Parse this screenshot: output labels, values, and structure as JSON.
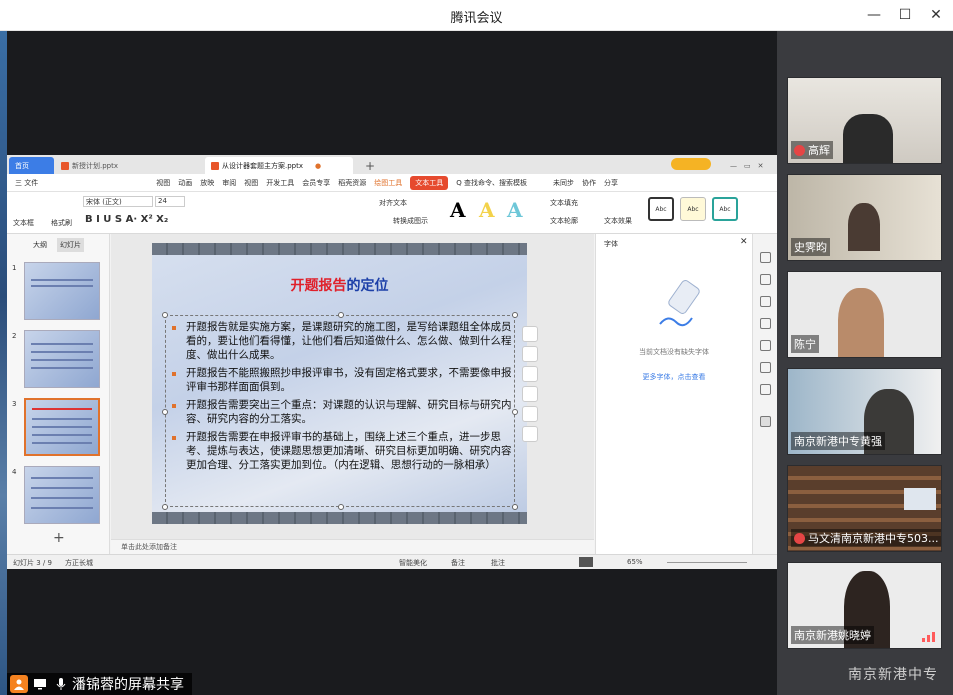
{
  "window": {
    "title": "腾讯会议"
  },
  "presenter": {
    "label": "潘锦蓉的屏幕共享"
  },
  "participants": [
    {
      "name": "高辉",
      "muted": true
    },
    {
      "name": "史霁昀",
      "muted": false
    },
    {
      "name": "陈宁",
      "muted": false
    },
    {
      "name": "南京新港中专黄强",
      "muted": false
    },
    {
      "name": "马文清南京新港中专503...",
      "muted": true
    },
    {
      "name": "南京新港姚晓婷",
      "muted": false
    }
  ],
  "watermark": "南京新港中专",
  "wps": {
    "tabs": {
      "home": "首页",
      "doc1": "新授计划.pptx",
      "doc2": "从设计器套题主方案.pptx"
    },
    "menu": [
      "三 文件",
      "视图",
      "动画",
      "放映",
      "审阅",
      "视图",
      "开发工具",
      "会员专享",
      "稻壳资源",
      "绘图工具",
      "文本工具",
      "Q 查找命令、搜索模板",
      "未同步",
      "协作",
      "分享"
    ],
    "active_menu": "文本工具",
    "ribbon": {
      "font_name": "宋体 (正文)",
      "font_size": "24",
      "styles": [
        "Abc",
        "Abc",
        "Abc"
      ],
      "text_fill": "文本填充",
      "text_outline": "文本轮廓",
      "text_effect": "文本效果",
      "align": "对齐文本",
      "convert": "转换成图示",
      "textbox": "文本框",
      "format": "格式刷"
    },
    "thumbs_tabs": [
      "大纲",
      "幻灯片"
    ],
    "thumb_numbers": [
      "1",
      "2",
      "3",
      "4"
    ],
    "slide": {
      "title_red": "开题报告",
      "title_blue": "的定位",
      "bullets": [
        "开题报告就是实施方案，是课题研究的施工图，是写给课题组全体成员看的，要让他们看得懂，让他们看后知道做什么、怎么做、做到什么程度、做出什么成果。",
        "开题报告不能照搬照抄申报评审书，没有固定格式要求，不需要像申报评审书那样面面俱到。",
        "开题报告需要突出三个重点：对课题的认识与理解、研究目标与研究内容、研究内容的分工落实。",
        "开题报告需要在申报评审书的基础上，围绕上述三个重点，进一步思考、提炼与表达，使课题思想更加清晰、研究目标更加明确、研究内容更加合理、分工落实更加到位。（内在逻辑、思想行动的一脉相承）"
      ]
    },
    "notes_placeholder": "单击此处添加备注",
    "font_pane": {
      "header": "字体",
      "empty_text": "当前文档没有缺失字体",
      "link": "更多字体，点击查看"
    },
    "status": {
      "slide_pos": "幻灯片 3 / 9",
      "theme": "方正长城",
      "smart": "智能美化",
      "notes": "备注",
      "comment": "批注",
      "zoom": "65%"
    }
  }
}
